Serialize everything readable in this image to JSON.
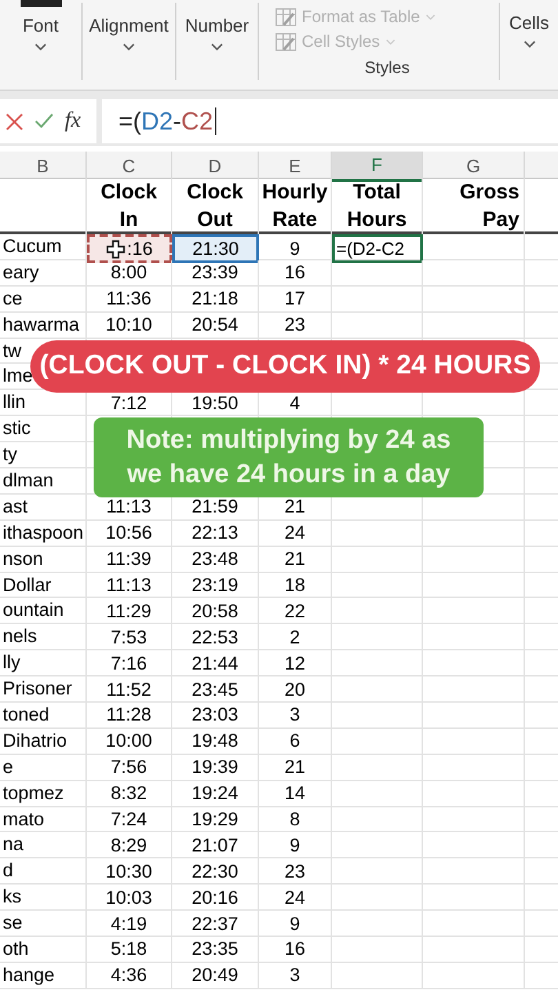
{
  "ribbon": {
    "groups": [
      {
        "label": "Font"
      },
      {
        "label": "Alignment"
      },
      {
        "label": "Number"
      }
    ],
    "styles": {
      "items": [
        {
          "label": "Format as Table"
        },
        {
          "label": "Cell Styles"
        }
      ],
      "label": "Styles"
    },
    "cells_group": {
      "label": "Cells"
    }
  },
  "formula_bar": {
    "fx": "fx",
    "tokens": [
      {
        "text": "=(",
        "color": "#222222"
      },
      {
        "text": "D2",
        "color": "#2e75b6"
      },
      {
        "text": "-",
        "color": "#222222"
      },
      {
        "text": "C2",
        "color": "#b0504d"
      }
    ]
  },
  "columns": [
    {
      "letter": "B",
      "selected": false
    },
    {
      "letter": "C",
      "selected": false
    },
    {
      "letter": "D",
      "selected": false
    },
    {
      "letter": "E",
      "selected": false
    },
    {
      "letter": "F",
      "selected": true
    },
    {
      "letter": "G",
      "selected": false
    }
  ],
  "headers": [
    {
      "lines": [
        "Clock",
        "In"
      ]
    },
    {
      "lines": [
        "Clock",
        "Out"
      ]
    },
    {
      "lines": [
        "Hourly",
        "Rate"
      ]
    },
    {
      "lines": [
        "Total",
        "Hours"
      ]
    },
    {
      "lines": [
        "Gross",
        "Pay"
      ]
    }
  ],
  "rows": [
    {
      "name": "Cucum",
      "clock_in": ":16",
      "clock_out": "21:30",
      "rate": "9",
      "total": "=(D2-C2",
      "in_copy_marquee": true,
      "out_referenced": true
    },
    {
      "name": "eary",
      "clock_in": "8:00",
      "clock_out": "23:39",
      "rate": "16"
    },
    {
      "name": "ce",
      "clock_in": "11:36",
      "clock_out": "21:18",
      "rate": "17"
    },
    {
      "name": "hawarma",
      "clock_in": "10:10",
      "clock_out": "20:54",
      "rate": "23"
    },
    {
      "name": "tw"
    },
    {
      "name": "lme"
    },
    {
      "name": "llin",
      "clock_in": "7:12",
      "clock_out": "19:50",
      "rate": "4"
    },
    {
      "name": "stic"
    },
    {
      "name": "ty"
    },
    {
      "name": "dlman"
    },
    {
      "name": "ast",
      "clock_in": "11:13",
      "clock_out": "21:59",
      "rate": "21"
    },
    {
      "name": "ithaspoon",
      "clock_in": "10:56",
      "clock_out": "22:13",
      "rate": "24"
    },
    {
      "name": "nson",
      "clock_in": "11:39",
      "clock_out": "23:48",
      "rate": "21"
    },
    {
      "name": "Dollar",
      "clock_in": "11:13",
      "clock_out": "23:19",
      "rate": "18"
    },
    {
      "name": "ountain",
      "clock_in": "11:29",
      "clock_out": "20:58",
      "rate": "22"
    },
    {
      "name": "nels",
      "clock_in": "7:53",
      "clock_out": "22:53",
      "rate": "2"
    },
    {
      "name": "lly",
      "clock_in": "7:16",
      "clock_out": "21:44",
      "rate": "12"
    },
    {
      "name": "Prisoner",
      "clock_in": "11:52",
      "clock_out": "23:45",
      "rate": "20"
    },
    {
      "name": "toned",
      "clock_in": "11:28",
      "clock_out": "23:03",
      "rate": "3"
    },
    {
      "name": "Dihatrio",
      "clock_in": "10:00",
      "clock_out": "19:48",
      "rate": "6"
    },
    {
      "name": "e",
      "clock_in": "7:56",
      "clock_out": "19:39",
      "rate": "21"
    },
    {
      "name": "topmez",
      "clock_in": "8:32",
      "clock_out": "19:24",
      "rate": "14"
    },
    {
      "name": "mato",
      "clock_in": "7:24",
      "clock_out": "19:29",
      "rate": "8"
    },
    {
      "name": "na",
      "clock_in": "8:29",
      "clock_out": "21:07",
      "rate": "9"
    },
    {
      "name": "d",
      "clock_in": "10:30",
      "clock_out": "22:30",
      "rate": "23"
    },
    {
      "name": "ks",
      "clock_in": "10:03",
      "clock_out": "20:16",
      "rate": "24"
    },
    {
      "name": "se",
      "clock_in": "4:19",
      "clock_out": "22:37",
      "rate": "9"
    },
    {
      "name": "oth",
      "clock_in": "5:18",
      "clock_out": "23:35",
      "rate": "16"
    },
    {
      "name": "hange",
      "clock_in": "4:36",
      "clock_out": "20:49",
      "rate": "3"
    }
  ],
  "banners": [
    {
      "kind": "formula",
      "lines": [
        "(CLOCK OUT - CLOCK IN) * 24 HOURS"
      ]
    },
    {
      "kind": "note",
      "lines": [
        "Note: multiplying by 24 as",
        "we have 24 hours in a day"
      ]
    }
  ]
}
